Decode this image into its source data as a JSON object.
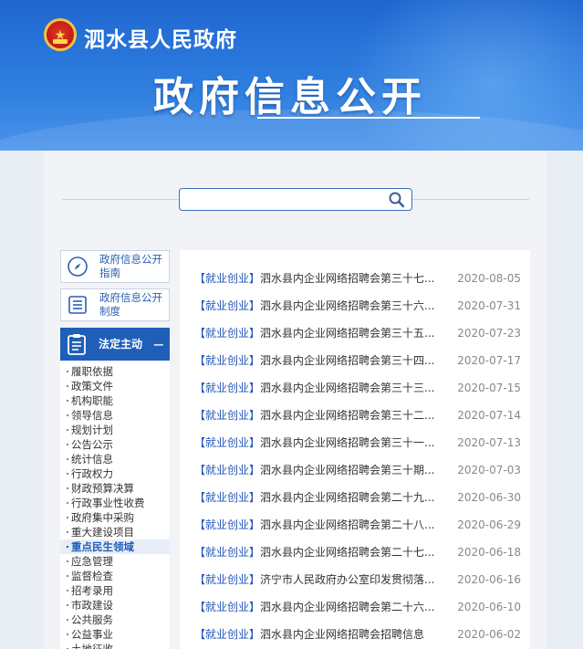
{
  "header": {
    "site_name": "泗水县人民政府",
    "page_title": "政府信息公开"
  },
  "search": {
    "value": "",
    "placeholder": ""
  },
  "sidebar": {
    "guide_label": "政府信息公开指南",
    "system_label": "政府信息公开制度",
    "active_section": {
      "label": "法定主动",
      "toggle": "−"
    },
    "items": [
      {
        "label": "履职依据"
      },
      {
        "label": "政策文件"
      },
      {
        "label": "机构职能"
      },
      {
        "label": "领导信息"
      },
      {
        "label": "规划计划"
      },
      {
        "label": "公告公示"
      },
      {
        "label": "统计信息"
      },
      {
        "label": "行政权力"
      },
      {
        "label": "财政预算决算"
      },
      {
        "label": "行政事业性收费"
      },
      {
        "label": "政府集中采购"
      },
      {
        "label": "重大建设项目"
      },
      {
        "label": "重点民生领域"
      },
      {
        "label": "应急管理"
      },
      {
        "label": "监督检查"
      },
      {
        "label": "招考录用"
      },
      {
        "label": "市政建设"
      },
      {
        "label": "公共服务"
      },
      {
        "label": "公益事业"
      },
      {
        "label": "土地征收"
      }
    ]
  },
  "news": {
    "items": [
      {
        "tag": "【就业创业】",
        "title": "泗水县内企业网络招聘会第三十七...",
        "date": "2020-08-05"
      },
      {
        "tag": "【就业创业】",
        "title": "泗水县内企业网络招聘会第三十六...",
        "date": "2020-07-31"
      },
      {
        "tag": "【就业创业】",
        "title": "泗水县内企业网络招聘会第三十五...",
        "date": "2020-07-23"
      },
      {
        "tag": "【就业创业】",
        "title": "泗水县内企业网络招聘会第三十四...",
        "date": "2020-07-17"
      },
      {
        "tag": "【就业创业】",
        "title": "泗水县内企业网络招聘会第三十三...",
        "date": "2020-07-15"
      },
      {
        "tag": "【就业创业】",
        "title": "泗水县内企业网络招聘会第三十二...",
        "date": "2020-07-14"
      },
      {
        "tag": "【就业创业】",
        "title": "泗水县内企业网络招聘会第三十一...",
        "date": "2020-07-13"
      },
      {
        "tag": "【就业创业】",
        "title": "泗水县内企业网络招聘会第三十期...",
        "date": "2020-07-03"
      },
      {
        "tag": "【就业创业】",
        "title": "泗水县内企业网络招聘会第二十九...",
        "date": "2020-06-30"
      },
      {
        "tag": "【就业创业】",
        "title": "泗水县内企业网络招聘会第二十八...",
        "date": "2020-06-29"
      },
      {
        "tag": "【就业创业】",
        "title": "泗水县内企业网络招聘会第二十七...",
        "date": "2020-06-18"
      },
      {
        "tag": "【就业创业】",
        "title": "济宁市人民政府办公室印发贯彻落...",
        "date": "2020-06-16"
      },
      {
        "tag": "【就业创业】",
        "title": "泗水县内企业网络招聘会第二十六...",
        "date": "2020-06-10"
      },
      {
        "tag": "【就业创业】",
        "title": "泗水县内企业网络招聘会招聘信息",
        "date": "2020-06-02"
      }
    ]
  },
  "colors": {
    "banner": "#2f7fe0",
    "accent": "#1f5fb8",
    "link": "#2356b6",
    "date": "#888888"
  },
  "icons": {
    "emblem": "national-emblem-icon",
    "search": "search-icon",
    "guide": "compass-icon",
    "system": "document-list-icon",
    "active_section": "clipboard-icon"
  }
}
